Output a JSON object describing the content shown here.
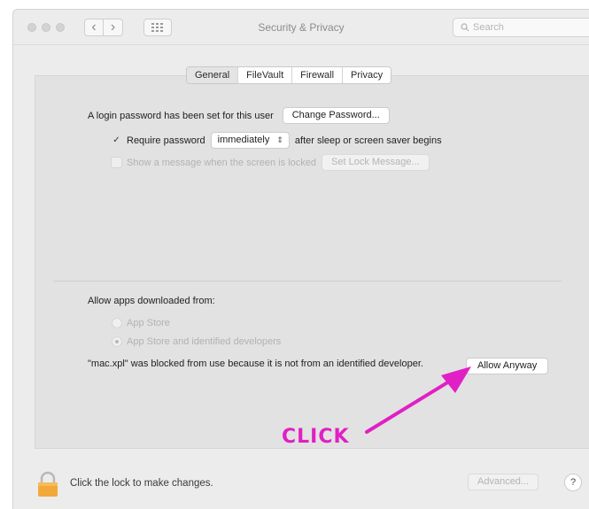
{
  "window": {
    "title": "Security & Privacy"
  },
  "toolbar": {
    "back_glyph": "‹",
    "forward_glyph": "›"
  },
  "search": {
    "placeholder": "Search"
  },
  "tabs": [
    {
      "label": "General",
      "active": true
    },
    {
      "label": "FileVault",
      "active": false
    },
    {
      "label": "Firewall",
      "active": false
    },
    {
      "label": "Privacy",
      "active": false
    }
  ],
  "general": {
    "login_password_text": "A login password has been set for this user",
    "change_password_label": "Change Password...",
    "require_password_label": "Require password",
    "require_password_checked": true,
    "require_password_interval": "immediately",
    "after_sleep_text": "after sleep or screen saver begins",
    "show_message_label": "Show a message when the screen is locked",
    "show_message_checked": false,
    "set_lock_message_label": "Set Lock Message..."
  },
  "allow_apps": {
    "heading": "Allow apps downloaded from:",
    "options": [
      {
        "label": "App Store",
        "selected": false
      },
      {
        "label": "App Store and identified developers",
        "selected": true
      }
    ],
    "blocked_message": "\"mac.xpl\" was blocked from use because it is not from an identified developer.",
    "allow_anyway_label": "Allow Anyway"
  },
  "annotation": {
    "label": "CLICK",
    "color": "#e020c4"
  },
  "footer": {
    "lock_text": "Click the lock to make changes.",
    "advanced_label": "Advanced...",
    "help_label": "?"
  },
  "colors": {
    "lock": "#f2a93b",
    "annotation": "#e020c4"
  },
  "icons": {
    "lock": "lock-icon",
    "search": "search-icon",
    "grid": "grid-icon"
  }
}
